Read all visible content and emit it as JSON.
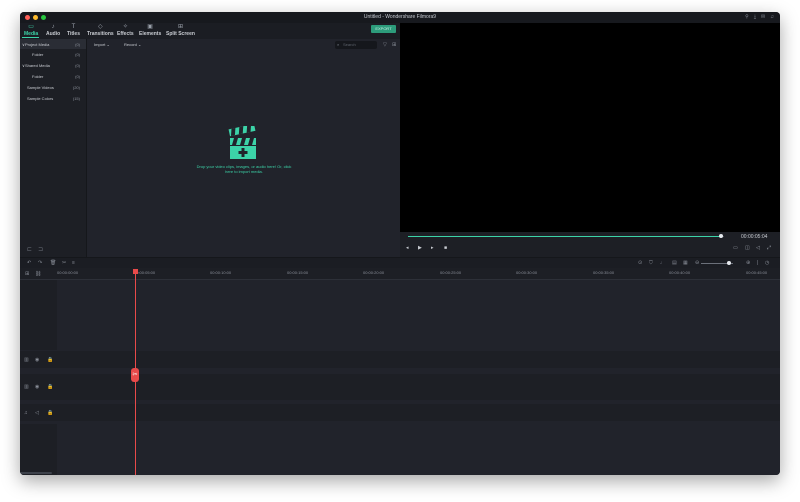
{
  "window": {
    "title": "Untitled - Wondershare Filmora9",
    "traffic_lights": [
      "#ff5f57",
      "#febc2e",
      "#28c840"
    ],
    "title_icons": [
      "person-icon",
      "download-icon",
      "mail-icon",
      "bell-icon"
    ]
  },
  "tabs": [
    {
      "label": "Media",
      "icon": "media-icon",
      "active": true
    },
    {
      "label": "Audio",
      "icon": "music-icon",
      "active": false
    },
    {
      "label": "Titles",
      "icon": "titles-icon",
      "active": false
    },
    {
      "label": "Transitions",
      "icon": "transitions-icon",
      "active": false
    },
    {
      "label": "Effects",
      "icon": "effects-icon",
      "active": false
    },
    {
      "label": "Elements",
      "icon": "elements-icon",
      "active": false
    },
    {
      "label": "Split Screen",
      "icon": "split-screen-icon",
      "active": false
    }
  ],
  "export_label": "EXPORT",
  "sidebar": {
    "items": [
      {
        "label": "Project Media",
        "count": "(0)",
        "expander": "∨",
        "selected": true
      },
      {
        "label": "Folder",
        "count": "(0)"
      },
      {
        "label": "Shared Media",
        "count": "(0)",
        "expander": "∨"
      },
      {
        "label": "Folder",
        "count": "(0)"
      },
      {
        "label": "Sample Videos",
        "count": "(20)"
      },
      {
        "label": "Sample Colors",
        "count": "(15)"
      }
    ]
  },
  "media_toolbar": {
    "import_label": "Import",
    "record_label": "Record",
    "search_placeholder": "Search"
  },
  "drop_area": {
    "line1": "Drop your video clips, images, or audio here! Or, click",
    "line2": "here to import media."
  },
  "preview": {
    "timecode": "00:00:05:04",
    "scrub_progress": 0.99
  },
  "timeline": {
    "ruler_ticks": [
      "00:00:00:00",
      "00:00:05:00",
      "00:00:10:00",
      "00:00:15:00",
      "00:00:20:00",
      "00:00:25:00",
      "00:00:30:00",
      "00:00:35:00",
      "00:00:40:00",
      "00:00:45:00"
    ],
    "playhead_timecode": "00:00:05:00",
    "zoom_level": 0.88
  },
  "colors": {
    "accent": "#3cd3a8",
    "playhead": "#e84a4a",
    "preview_bg": "#000000"
  }
}
